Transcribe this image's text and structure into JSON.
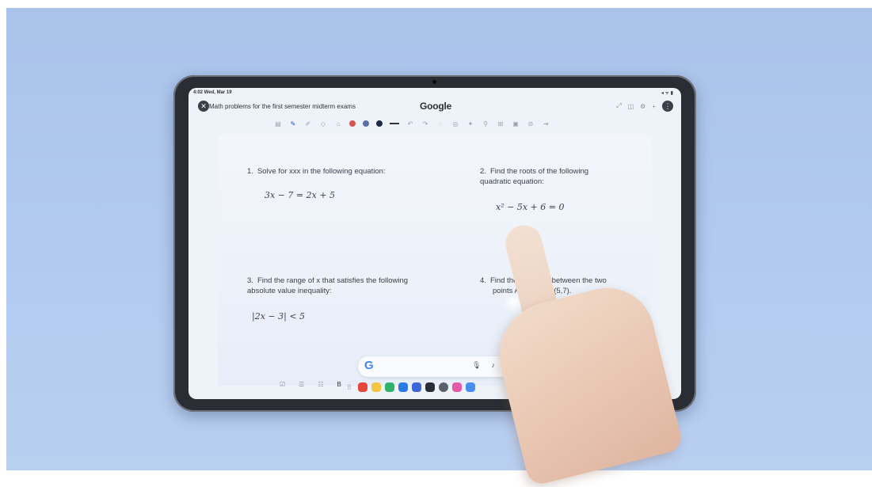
{
  "status": {
    "time": "4:02 Wed, Mar 19"
  },
  "titlebar": {
    "doc_title": "Math problems for the first semester midterm exams",
    "brand": "Google"
  },
  "toolbar": {
    "colors": [
      "#d9534f",
      "#5b6fa8",
      "#1f2a44"
    ]
  },
  "questions": [
    {
      "num": "1.",
      "text": "Solve for xxx in the following equation:",
      "equation": "3x − 7 = 2x + 5"
    },
    {
      "num": "2.",
      "text": "Find the roots of the following quadratic equation:",
      "equation": "x² − 5x + 6 = 0"
    },
    {
      "num": "3.",
      "text": "Find the range of x that satisfies the following absolute value inequality:",
      "equation": "|2x − 3| < 5"
    },
    {
      "num": "4.",
      "text": "Find the",
      "text2": "ce between the two",
      "text3": "points A(",
      "text4": "dB(5,7)."
    }
  ],
  "search": {
    "logo": "G"
  },
  "bottom_tools": {
    "b_label": "B"
  }
}
